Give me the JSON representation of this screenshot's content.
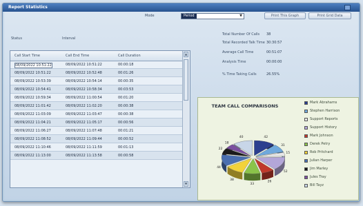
{
  "window": {
    "title": "Report Statistics"
  },
  "header": {
    "mode_label": "Mode",
    "mode_value": "Period",
    "btn_print_graph": "Print This Graph",
    "btn_print_grid": "Print Grid Data",
    "status_label": "Status",
    "interval_label": "Interval"
  },
  "stats": [
    {
      "label": "Total Number Of Calls",
      "value": "38"
    },
    {
      "label": "Total Recorded Talk Time",
      "value": "30:30:57"
    },
    {
      "label": "Average Call Time",
      "value": "00:51:07"
    },
    {
      "label": "Analysis Time",
      "value": "00:00:00"
    },
    {
      "label": "% Time Taking Calls",
      "value": "26.55%"
    }
  ],
  "grid": {
    "headers": [
      "Call Start Time",
      "Call End Time",
      "Call Duration"
    ],
    "rows": [
      [
        "08/09/2022 10:51:22",
        "08/09/2022 10:51:22",
        "00:00:18"
      ],
      [
        "08/09/2022 10:51:22",
        "08/09/2022 10:52:48",
        "00:01:26"
      ],
      [
        "08/09/2022 10:53:39",
        "08/09/2022 10:54:14",
        "00:00:35"
      ],
      [
        "08/09/2022 10:54:41",
        "08/09/2022 10:58:34",
        "00:03:53"
      ],
      [
        "08/09/2022 10:59:34",
        "08/09/2022 11:00:54",
        "00:01:20"
      ],
      [
        "08/09/2022 11:01:42",
        "08/09/2022 11:02:20",
        "00:00:38"
      ],
      [
        "08/09/2022 11:03:09",
        "08/09/2022 11:03:47",
        "00:00:38"
      ],
      [
        "08/09/2022 11:04:21",
        "08/09/2022 11:05:17",
        "00:00:56"
      ],
      [
        "08/09/2022 11:06:27",
        "08/09/2022 11:07:48",
        "00:01:21"
      ],
      [
        "08/09/2022 11:08:52",
        "08/09/2022 11:09:44",
        "00:00:52"
      ],
      [
        "08/09/2022 11:10:46",
        "08/09/2022 11:11:59",
        "00:01:13"
      ],
      [
        "08/09/2022 11:13:00",
        "08/09/2022 11:13:58",
        "00:00:58"
      ]
    ]
  },
  "chart_data": {
    "type": "pie",
    "title": "TEAM CALL COMPARISONS",
    "categories": [
      "Mark Abrahams",
      "Stephen Harrison",
      "Support Reports",
      "Support History",
      "Mark Johnson",
      "Derek Petry",
      "Rob Pritchard",
      "Julian Harper",
      "Jim Marley",
      "Jules Tray",
      "Bill Tayz"
    ],
    "values": [
      42,
      31,
      15,
      52,
      26,
      33,
      38,
      44,
      22,
      18,
      40
    ],
    "colors": [
      "#2b3f8f",
      "#6fa8dc",
      "#e6e6e6",
      "#b3a6d9",
      "#c0392b",
      "#8bc34a",
      "#f2d23a",
      "#4a6fb0",
      "#1a1a1a",
      "#7b4fa0",
      "#c8d6e8"
    ]
  }
}
